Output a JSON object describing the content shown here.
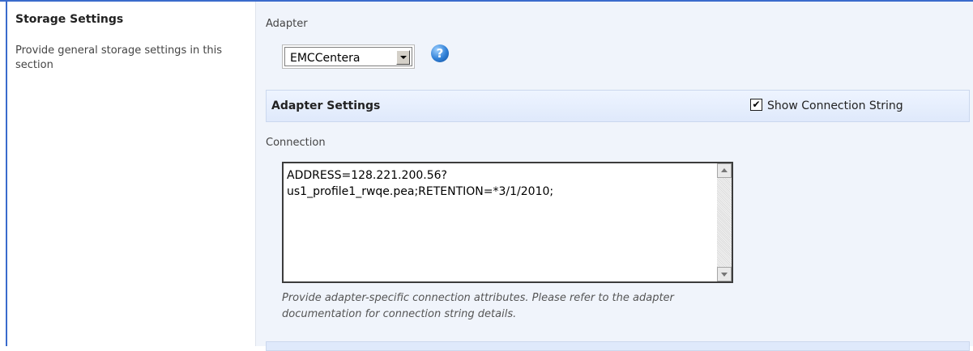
{
  "left": {
    "title": "Storage Settings",
    "description": "Provide general storage settings in this section"
  },
  "adapter": {
    "label": "Adapter",
    "selected": "EMCCentera"
  },
  "adapter_settings": {
    "title": "Adapter Settings",
    "show_connection_label": "Show Connection String",
    "show_connection_checked": true
  },
  "connection": {
    "label": "Connection",
    "value": "ADDRESS=128.221.200.56?\nus1_profile1_rwqe.pea;RETENTION=*3/1/2010;",
    "help": "Provide adapter-specific connection attributes. Please refer to the adapter documentation for connection string details."
  },
  "colors": {
    "accent": "#3a6bcc",
    "panel_bg": "#f0f4fb"
  },
  "icons": {
    "help": "help-icon",
    "dropdown": "chevron-down-icon",
    "check": "checkmark-icon"
  }
}
